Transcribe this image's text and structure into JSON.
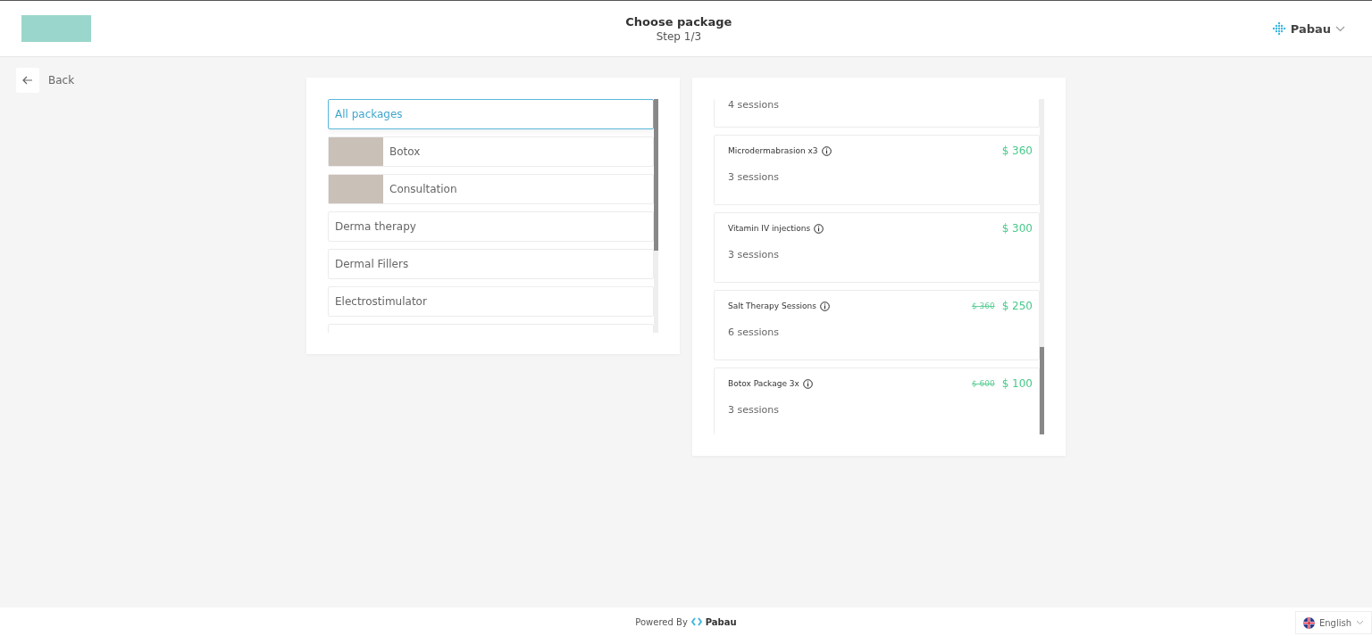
{
  "header": {
    "title": "Choose package",
    "step": "Step 1/3",
    "account": "Pabau"
  },
  "back": {
    "label": "Back"
  },
  "categories": [
    {
      "label": "All packages",
      "selected": true,
      "kind": "plain"
    },
    {
      "label": "Botox",
      "selected": false,
      "kind": "photo"
    },
    {
      "label": "Consultation",
      "selected": false,
      "kind": "photo"
    },
    {
      "label": "Derma therapy",
      "selected": false,
      "kind": "plain"
    },
    {
      "label": "Dermal Fillers",
      "selected": false,
      "kind": "plain"
    },
    {
      "label": "Electrostimulator",
      "selected": false,
      "kind": "plain"
    }
  ],
  "packages": [
    {
      "kind": "cut",
      "sessions": "4 sessions"
    },
    {
      "kind": "full",
      "name": "Microdermabrasion x3",
      "price": "$ 360",
      "sessions": "3 sessions"
    },
    {
      "kind": "full",
      "name": "Vitamin IV injections",
      "price": "$ 300",
      "sessions": "3 sessions"
    },
    {
      "kind": "full",
      "name": "Salt Therapy Sessions",
      "old_price": "$ 360",
      "price": "$ 250",
      "sessions": "6 sessions"
    },
    {
      "kind": "full",
      "name": "Botox Package 3x",
      "old_price": "$ 600",
      "price": "$ 100",
      "sessions": "3 sessions"
    }
  ],
  "footer": {
    "powered_by": "Powered By",
    "brand": "Pabau",
    "language": "English"
  }
}
